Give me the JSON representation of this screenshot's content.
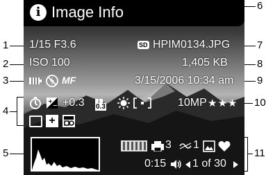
{
  "title_bar": {
    "title": "Image Info"
  },
  "info": {
    "shutter_aperture": "1/15 F3.6",
    "iso": "ISO 100",
    "filename": "HPIM0134.JPG",
    "filesize": "1,405 KB",
    "datetime": "3/15/2006 10:34 am",
    "ev": "+0.3",
    "resolution": "10MP",
    "quality_stars": "★★★",
    "print_count": "3",
    "email_count": "1",
    "duration": "0:15",
    "image_position": "1 of 30",
    "sd_label": "SD",
    "mf_label": "MF",
    "bracket_label": "0.3"
  },
  "callouts": [
    "1",
    "2",
    "3",
    "4",
    "5",
    "6",
    "7",
    "8",
    "9",
    "10",
    "11"
  ],
  "icons": [
    "info-icon",
    "sd-card-icon",
    "battery-icon",
    "flash-off-icon",
    "self-timer-icon",
    "exposure-compensation-icon",
    "bracket-icon",
    "white-balance-icon",
    "metering-icon",
    "panorama-icon",
    "plus-icon",
    "video-icon",
    "histogram",
    "film-strip-icon",
    "printer-icon",
    "email-icon",
    "favorite-image-icon",
    "heart-icon",
    "speaker-icon",
    "left-arrow-icon",
    "right-arrow-icon"
  ]
}
